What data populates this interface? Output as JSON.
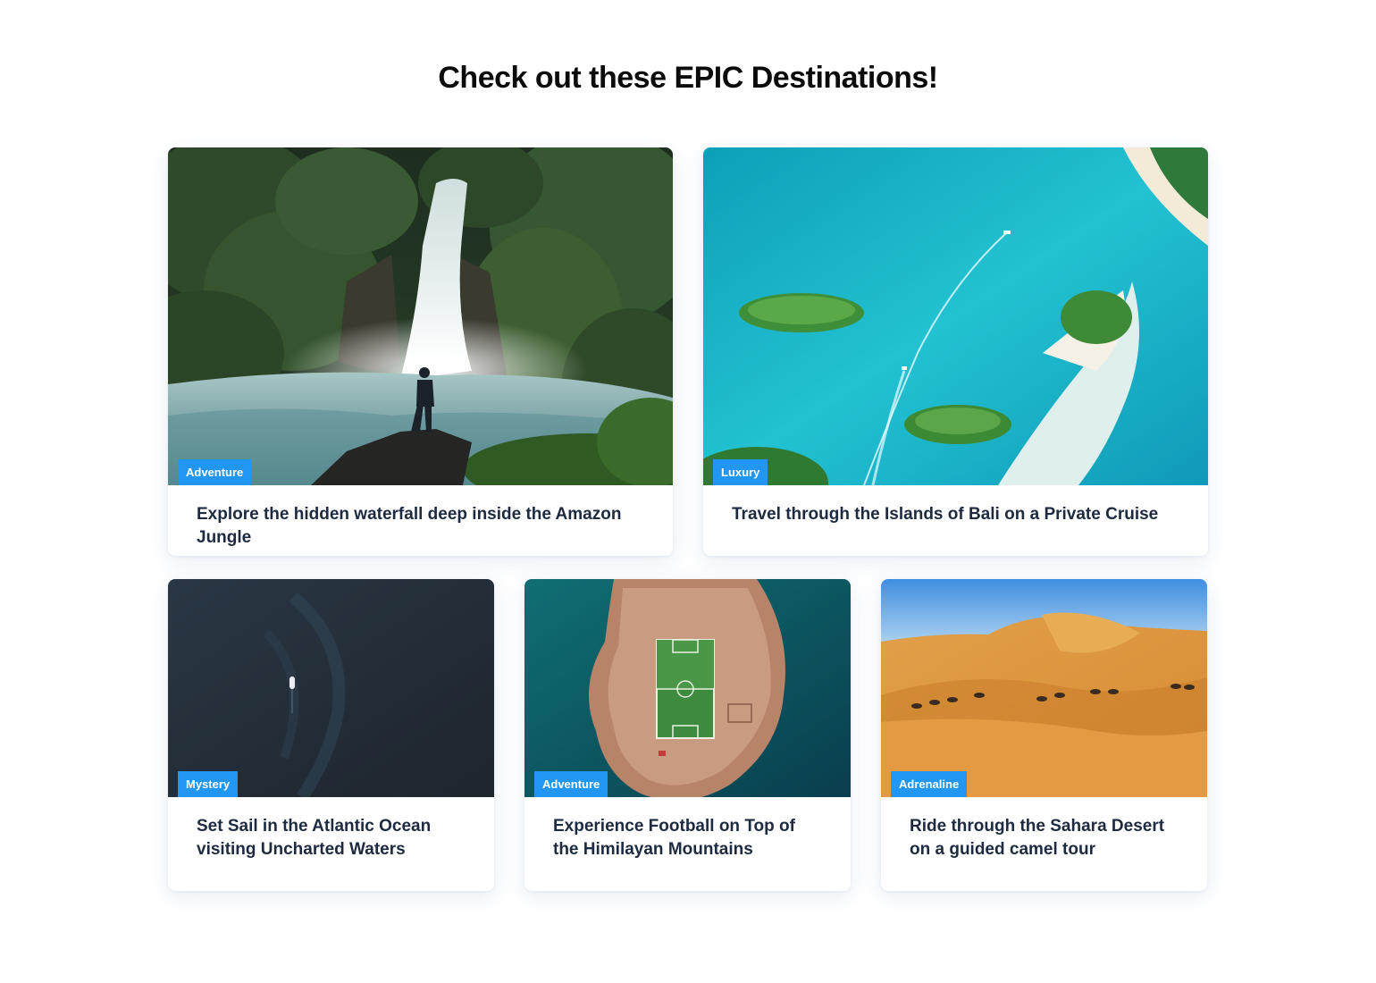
{
  "page": {
    "title": "Check out these EPIC Destinations!"
  },
  "theme": {
    "tag_color": "#2196f3",
    "title_color": "#1d2a3f"
  },
  "cards": [
    {
      "tag": "Adventure",
      "title": "Explore the hidden waterfall deep inside the Amazon Jungle",
      "image": "waterfall-jungle-photo"
    },
    {
      "tag": "Luxury",
      "title": "Travel through the Islands of Bali on a Private Cruise",
      "image": "aerial-islands-photo"
    },
    {
      "tag": "Mystery",
      "title": "Set Sail in the Atlantic Ocean visiting Uncharted Waters",
      "image": "ocean-boat-photo"
    },
    {
      "tag": "Adventure",
      "title": "Experience Football on Top of the Himilayan Mountains",
      "image": "island-football-field-photo"
    },
    {
      "tag": "Adrenaline",
      "title": "Ride through the Sahara Desert on a guided camel tour",
      "image": "desert-camels-photo"
    }
  ]
}
